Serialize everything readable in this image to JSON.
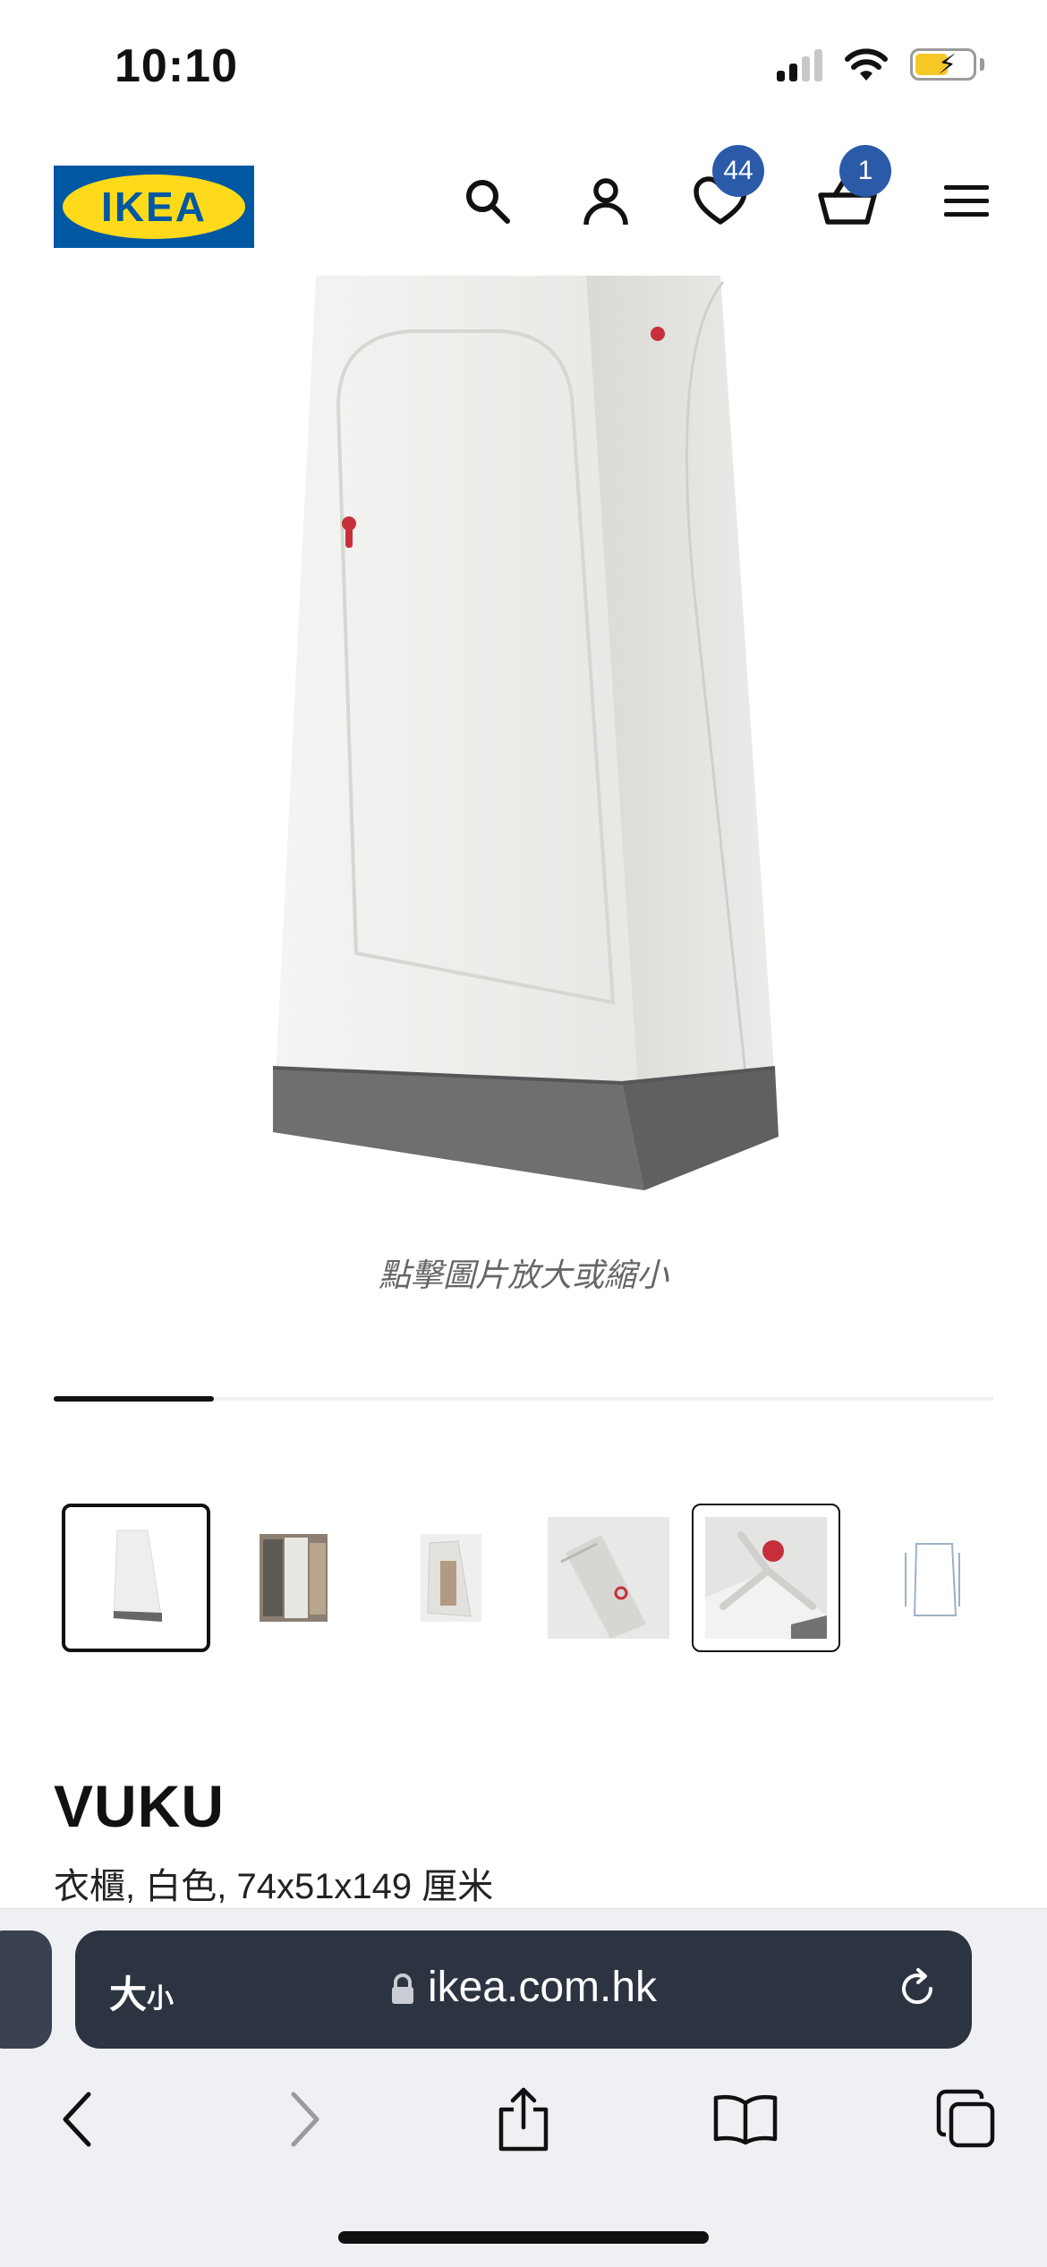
{
  "status_bar": {
    "time": "10:10"
  },
  "header": {
    "logo_text": "IKEA",
    "wishlist_count": "44",
    "cart_count": "1"
  },
  "gallery": {
    "zoom_hint": "點擊圖片放大或縮小",
    "progress": 0.17,
    "thumbnails": [
      "thumbnail-1",
      "thumbnail-2",
      "thumbnail-3",
      "thumbnail-4",
      "thumbnail-5",
      "thumbnail-6"
    ]
  },
  "product": {
    "name": "VUKU",
    "description": "衣櫃, 白色, 74x51x149 厘米"
  },
  "browser": {
    "text_size_label": "大",
    "text_size_small": "小",
    "url": "ikea.com.hk"
  },
  "colors": {
    "brand_blue": "#0058a3",
    "brand_yellow": "#ffda1a",
    "badge_blue": "#2b5ba8"
  }
}
